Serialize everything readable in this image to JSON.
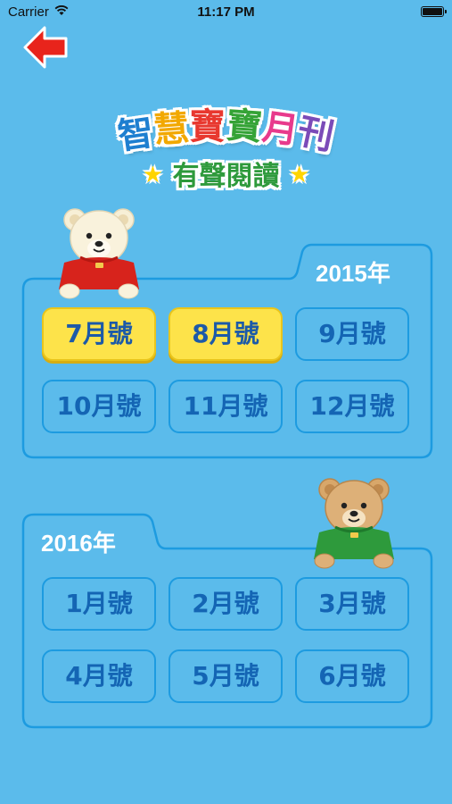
{
  "status": {
    "carrier": "Carrier",
    "time": "11:17 PM"
  },
  "header": {
    "title_chars": [
      "智",
      "慧",
      "寶",
      "寶",
      "月",
      "刊"
    ],
    "subtitle": "有聲閱讀",
    "star": "★"
  },
  "sections": [
    {
      "year": "2015年",
      "buttons": [
        {
          "label": "7月號",
          "available": true
        },
        {
          "label": "8月號",
          "available": true
        },
        {
          "label": "9月號",
          "available": false
        },
        {
          "label": "10月號",
          "available": false
        },
        {
          "label": "11月號",
          "available": false
        },
        {
          "label": "12月號",
          "available": false
        }
      ]
    },
    {
      "year": "2016年",
      "buttons": [
        {
          "label": "1月號",
          "available": false
        },
        {
          "label": "2月號",
          "available": false
        },
        {
          "label": "3月號",
          "available": false
        },
        {
          "label": "4月號",
          "available": false
        },
        {
          "label": "5月號",
          "available": false
        },
        {
          "label": "6月號",
          "available": false
        }
      ]
    }
  ],
  "colors": {
    "background": "#5bbbeb",
    "frame": "#1d9be0",
    "button_active": "#fde34a",
    "button_text": "#1465b4",
    "back_arrow": "#e8241c"
  },
  "icons": [
    "back-arrow-icon",
    "wifi-icon",
    "battery-icon",
    "bear-red-sweater",
    "bear-green-sweater"
  ]
}
